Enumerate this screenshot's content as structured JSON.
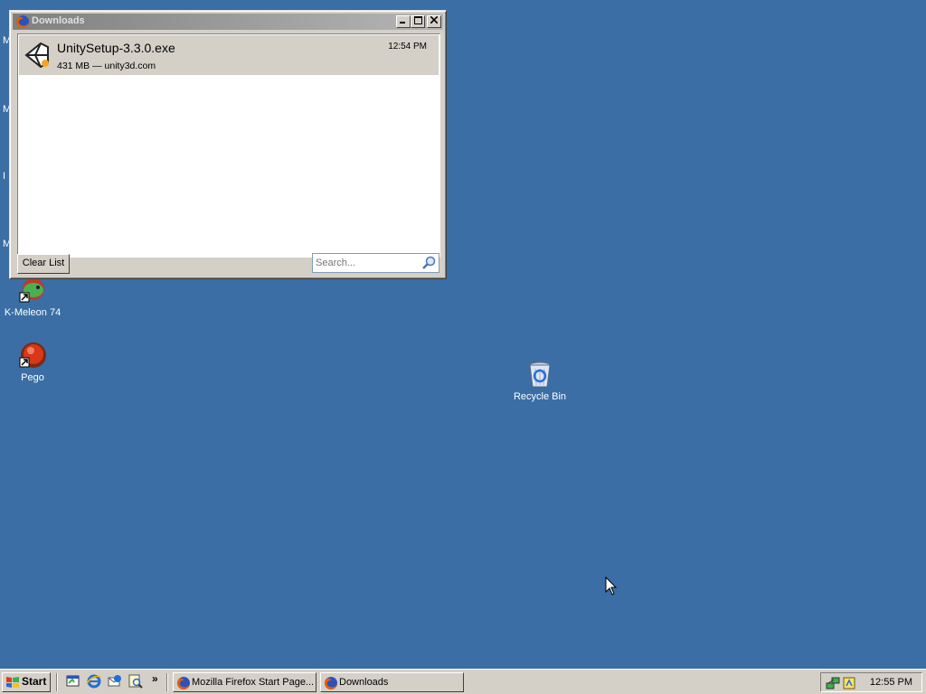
{
  "desktop": {
    "icons": [
      {
        "label": "K-Meleon 74"
      },
      {
        "label": "Pego"
      },
      {
        "label": "Recycle Bin"
      }
    ],
    "edge_fragments": [
      "M",
      "M",
      "I",
      "M"
    ]
  },
  "downloads_window": {
    "title": "Downloads",
    "items": [
      {
        "name": "UnitySetup-3.3.0.exe",
        "info": "431 MB — unity3d.com",
        "time": "12:54 PM"
      }
    ],
    "clear_list_label": "Clear List",
    "search_placeholder": "Search..."
  },
  "taskbar": {
    "start_label": "Start",
    "chevron": "»",
    "tasks": [
      {
        "label": "Mozilla Firefox Start Page..."
      },
      {
        "label": "Downloads"
      }
    ],
    "clock": "12:55 PM"
  },
  "colors": {
    "desktop": "#3a6ea5",
    "chrome": "#d4d0c8",
    "inactive_title_start": "#808080",
    "inactive_title_end": "#b5b5b5"
  }
}
